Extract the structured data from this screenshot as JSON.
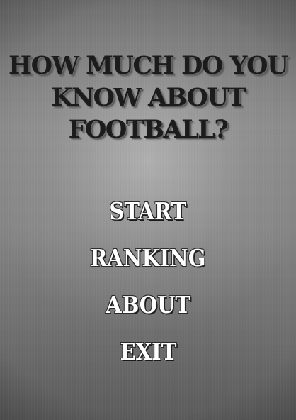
{
  "title": {
    "line1": "HOW MUCH DO YOU",
    "line2": "KNOW ABOUT",
    "line3": "FOOTBALL?"
  },
  "menu": {
    "start": "START",
    "ranking": "RANKING",
    "about": "ABOUT",
    "exit": "EXIT"
  },
  "colors": {
    "title_text": "#1c1c1c",
    "menu_text": "#ffffff",
    "background": "#7d7d7d"
  }
}
